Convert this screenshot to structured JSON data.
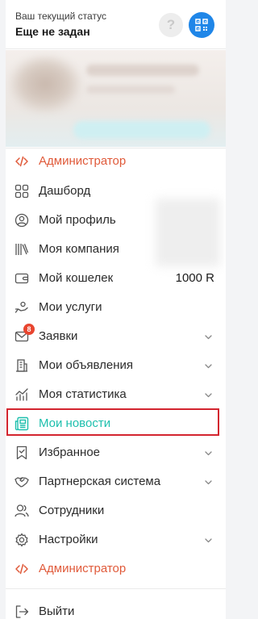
{
  "status": {
    "label": "Ваш текущий статус",
    "value": "Еще не задан"
  },
  "header_buttons": {
    "help": "?"
  },
  "menu": [
    {
      "id": "admin-top",
      "label": "Администратор",
      "icon": "code-icon",
      "variant": "admin"
    },
    {
      "id": "dashboard",
      "label": "Дашборд",
      "icon": "grid-icon"
    },
    {
      "id": "profile",
      "label": "Мой профиль",
      "icon": "user-circle-icon"
    },
    {
      "id": "company",
      "label": "Моя компания",
      "icon": "books-icon"
    },
    {
      "id": "wallet",
      "label": "Мой кошелек",
      "icon": "wallet-icon",
      "amount": "1000 R"
    },
    {
      "id": "services",
      "label": "Мои услуги",
      "icon": "hand-service-icon"
    },
    {
      "id": "requests",
      "label": "Заявки",
      "icon": "mail-icon",
      "badge": "8",
      "chevron": true
    },
    {
      "id": "ads",
      "label": "Мои объявления",
      "icon": "building-icon",
      "chevron": true
    },
    {
      "id": "stats",
      "label": "Моя статистика",
      "icon": "chart-icon",
      "chevron": true
    },
    {
      "id": "news",
      "label": "Мои новости",
      "icon": "newspaper-icon",
      "variant": "active"
    },
    {
      "id": "favorites",
      "label": "Избранное",
      "icon": "bookmark-icon",
      "chevron": true
    },
    {
      "id": "partners",
      "label": "Партнерская система",
      "icon": "handshake-icon",
      "chevron": true
    },
    {
      "id": "staff",
      "label": "Сотрудники",
      "icon": "users-icon"
    },
    {
      "id": "settings",
      "label": "Настройки",
      "icon": "gear-icon",
      "chevron": true
    },
    {
      "id": "admin-bottom",
      "label": "Администратор",
      "icon": "code-icon",
      "variant": "admin"
    },
    {
      "id": "logout",
      "label": "Выйти",
      "icon": "logout-icon"
    }
  ],
  "colors": {
    "accent_admin": "#e05a3a",
    "accent_active": "#1dbfad",
    "qr_button": "#1f86e8",
    "badge": "#e8452f",
    "highlight_frame": "#d3252f"
  }
}
